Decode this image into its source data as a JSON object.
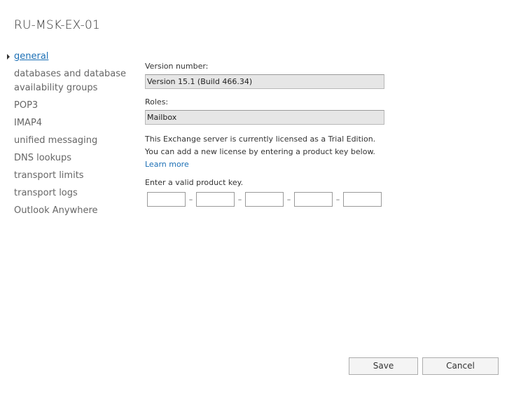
{
  "window": {
    "title": "RU-MSK-EX-01"
  },
  "nav": {
    "items": [
      {
        "label": "general",
        "active": true
      },
      {
        "label": "databases and database availability groups",
        "active": false
      },
      {
        "label": "POP3",
        "active": false
      },
      {
        "label": "IMAP4",
        "active": false
      },
      {
        "label": "unified messaging",
        "active": false
      },
      {
        "label": "DNS lookups",
        "active": false
      },
      {
        "label": "transport limits",
        "active": false
      },
      {
        "label": "transport logs",
        "active": false
      },
      {
        "label": "Outlook Anywhere",
        "active": false
      }
    ]
  },
  "general": {
    "version_label": "Version number:",
    "version_value": "Version 15.1 (Build 466.34)",
    "roles_label": "Roles:",
    "roles_value": "Mailbox",
    "license_notice": "This Exchange server is currently licensed as a Trial Edition. You can add a new license by entering a product key below.",
    "learn_more": "Learn more",
    "product_key_label": "Enter a valid product key.",
    "key_separator": "–"
  },
  "buttons": {
    "save": "Save",
    "cancel": "Cancel"
  },
  "colors": {
    "link": "#1b6fb5",
    "readonly_bg": "#e6e6e6"
  }
}
